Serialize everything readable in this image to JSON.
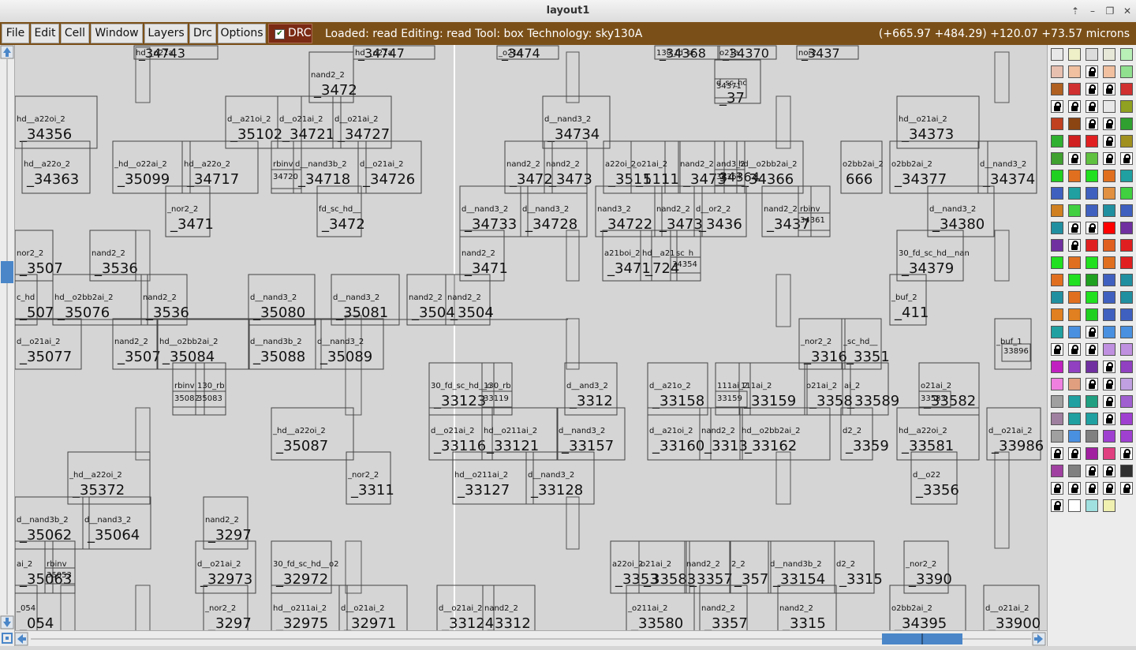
{
  "window": {
    "title": "layout1",
    "controls": [
      "up-arrow-icon",
      "minimize-icon",
      "maximize-icon",
      "close-icon"
    ]
  },
  "menu": {
    "items": [
      "File",
      "Edit",
      "Cell",
      "Window",
      "Layers",
      "Drc",
      "Options"
    ],
    "drc_toggle": {
      "label": "DRC",
      "checked": true
    }
  },
  "status": {
    "message": "Loaded: read Editing: read Tool: box  Technology: sky130A",
    "coordinates": "(+665.97 +484.29) +120.07 +73.57 microns"
  },
  "colors": {
    "menubar": "#7b5018",
    "drc_button": "#7b2a14",
    "scroll_thumb": "#4a86c8"
  },
  "scrollbars": {
    "horizontal_thumb_fraction": [
      0.838,
      0.925
    ],
    "vertical_thumb_fraction": [
      0.36,
      0.4
    ]
  },
  "cells": [
    {
      "small": "hd__o21a",
      "big": "_34743"
    },
    {
      "small": "hd__o21a",
      "big": "_34747"
    },
    {
      "small": "_o21a",
      "big": "_3474"
    },
    {
      "small": "130_fd_sc",
      "big": "_34368"
    },
    {
      "small": "o21a",
      "big": "_34370"
    },
    {
      "small": "nor2",
      "big": "_3437"
    },
    {
      "small": "nand2_2",
      "big": "_3472"
    },
    {
      "small": "d_sc_hc",
      "big": "_37"
    },
    {
      "small": "34371",
      "big": ""
    },
    {
      "small": "hd__a22oi_2",
      "big": "_34356"
    },
    {
      "small": "d__a21oi_2",
      "big": "_35102"
    },
    {
      "small": "d__o21ai_2",
      "big": "_34721"
    },
    {
      "small": "d__o21ai_2",
      "big": "_34727"
    },
    {
      "small": "d__nand3_2",
      "big": "_34734"
    },
    {
      "small": "hd__o21ai_2",
      "big": "_34373"
    },
    {
      "small": "hd__a22o_2",
      "big": "_34363"
    },
    {
      "small": "_hd__o22ai_2",
      "big": "_35099"
    },
    {
      "small": "hd__a22o_2",
      "big": "_34717"
    },
    {
      "small": "rbinv",
      "big": ""
    },
    {
      "small": "34720",
      "big": ""
    },
    {
      "small": "d__nand3b_2",
      "big": "_34718"
    },
    {
      "small": "d__o21ai_2",
      "big": "_34726"
    },
    {
      "small": "nand2_2",
      "big": "_3472"
    },
    {
      "small": "nand2_2",
      "big": "_3473"
    },
    {
      "small": "a22oi_2",
      "big": "_3511"
    },
    {
      "small": "_o21ai_2",
      "big": "_5111"
    },
    {
      "small": "nand2_2",
      "big": "_3473"
    },
    {
      "small": "and3_2",
      "big": ""
    },
    {
      "small": "34364",
      "big": "34364"
    },
    {
      "small": "hd__o2bb2ai_2",
      "big": "_34366"
    },
    {
      "small": "o2bb2ai_2",
      "big": "666"
    },
    {
      "small": "o2bb2ai_2",
      "big": "_34377"
    },
    {
      "small": "d__nand3_2",
      "big": "_34374"
    },
    {
      "small": "_nor2_2",
      "big": "_3471"
    },
    {
      "small": "fd_sc_hd__",
      "big": "_3472"
    },
    {
      "small": "d__nand3_2",
      "big": "_34733"
    },
    {
      "small": "d__nand3_2",
      "big": "_34728"
    },
    {
      "small": "nand3_2",
      "big": "_34722"
    },
    {
      "small": "nand2_2",
      "big": "_3473"
    },
    {
      "small": "d__or2_2",
      "big": "_3436"
    },
    {
      "small": "nand2_2",
      "big": "_3437"
    },
    {
      "small": "rbinv",
      "big": ""
    },
    {
      "small": "34361",
      "big": ""
    },
    {
      "small": "d__nand3_2",
      "big": "_34380"
    },
    {
      "small": "nor2_2",
      "big": "_3507"
    },
    {
      "small": "nand2_2",
      "big": "_3536"
    },
    {
      "small": "nand2_2",
      "big": "_3471"
    },
    {
      "small": "a21boi_2",
      "big": "_3471"
    },
    {
      "small": "hd__a21",
      "big": "_724"
    },
    {
      "small": "_sc_h",
      "big": ""
    },
    {
      "small": "34354",
      "big": ""
    },
    {
      "small": "30_fd_sc_hd__nan",
      "big": "_34379"
    },
    {
      "small": "c_hd",
      "big": "_507"
    },
    {
      "small": "hd__o2bb2ai_2",
      "big": "_35076"
    },
    {
      "small": "nand2_2",
      "big": "_3536"
    },
    {
      "small": "d__nand3_2",
      "big": "_35080"
    },
    {
      "small": "d__nand3_2",
      "big": "_35081"
    },
    {
      "small": "nand2_2",
      "big": "_3504"
    },
    {
      "small": "nand2_2",
      "big": "_3504"
    },
    {
      "small": "_buf_2",
      "big": "_411"
    },
    {
      "small": "d__o21ai_2",
      "big": "_35077"
    },
    {
      "small": "nand2_2",
      "big": "_3507"
    },
    {
      "small": "hd__o2bb2ai_2",
      "big": "_35084"
    },
    {
      "small": "d__nand3b_2",
      "big": "_35088"
    },
    {
      "small": "d__nand3_2",
      "big": "_35089"
    },
    {
      "small": "_nor2_2",
      "big": "_3316"
    },
    {
      "small": "_sc_hd__",
      "big": "_3351"
    },
    {
      "small": "_buf_1",
      "big": ""
    },
    {
      "small": "33896",
      "big": ""
    },
    {
      "small": "rbinv",
      "big": ""
    },
    {
      "small": "130_rb",
      "big": ""
    },
    {
      "small": "35082",
      "big": ""
    },
    {
      "small": "35083",
      "big": ""
    },
    {
      "small": "30_fd_sc_hd__o",
      "big": "_33123"
    },
    {
      "small": "130_rb",
      "big": ""
    },
    {
      "small": "33119",
      "big": ""
    },
    {
      "small": "d__and3_2",
      "big": "_3312"
    },
    {
      "small": "d__a21o_2",
      "big": "_33158"
    },
    {
      "small": "111ai_2",
      "big": ""
    },
    {
      "small": "33159",
      "big": ""
    },
    {
      "small": "111ai_2",
      "big": "_33159"
    },
    {
      "small": "o21ai_2",
      "big": "_3358"
    },
    {
      "small": "ai_2",
      "big": "_33589"
    },
    {
      "small": "o21ai_2",
      "big": "_33582"
    },
    {
      "small": "33583",
      "big": ""
    },
    {
      "small": "_hd__a22oi_2",
      "big": "_35087"
    },
    {
      "small": "d__o21ai_2",
      "big": "_33116"
    },
    {
      "small": "hd__o211ai_2",
      "big": "_33121"
    },
    {
      "small": "d__nand3_2",
      "big": "_33157"
    },
    {
      "small": "d__a21oi_2",
      "big": "_33160"
    },
    {
      "small": "nand2_2",
      "big": "_3313"
    },
    {
      "small": "hd__o2bb2ai_2",
      "big": "_33162"
    },
    {
      "small": "d2_2",
      "big": "_3359"
    },
    {
      "small": "hd__a22oi_2",
      "big": "_33581"
    },
    {
      "small": "d__o21ai_2",
      "big": "_33986"
    },
    {
      "small": "_hd__a22oi_2",
      "big": "_35372"
    },
    {
      "small": "_nor2_2",
      "big": "_3311"
    },
    {
      "small": "hd__o211ai_2",
      "big": "_33127"
    },
    {
      "small": "d__nand3_2",
      "big": "_33128"
    },
    {
      "small": "d__o22",
      "big": "_3356"
    },
    {
      "small": "d__nand3b_2",
      "big": "_35062"
    },
    {
      "small": "d__nand3_2",
      "big": "_35064"
    },
    {
      "small": "nand2_2",
      "big": "_3297"
    },
    {
      "small": "ai_2",
      "big": "_35063"
    },
    {
      "small": "rbinv",
      "big": ""
    },
    {
      "small": "35053",
      "big": ""
    },
    {
      "small": "d__o21ai_2",
      "big": "_32973"
    },
    {
      "small": "30_fd_sc_hd__o2",
      "big": "_32972"
    },
    {
      "small": "a22oi_2",
      "big": "_3353"
    },
    {
      "small": "o21ai_2",
      "big": "_33583"
    },
    {
      "small": "nand2_2",
      "big": "_3357"
    },
    {
      "small": "2_2",
      "big": "_357"
    },
    {
      "small": "d__nand3b_2",
      "big": "_33154"
    },
    {
      "small": "d2_2",
      "big": "_3315"
    },
    {
      "small": "_nor2_2",
      "big": "_3390"
    },
    {
      "small": "_054",
      "big": "_054"
    },
    {
      "small": "_nor2_2",
      "big": "_3297"
    },
    {
      "small": "hd__o211ai_2",
      "big": "_32975"
    },
    {
      "small": "d__o21ai_2",
      "big": "_32971"
    },
    {
      "small": "d__o21ai_2",
      "big": "_33124"
    },
    {
      "small": "nand2_2",
      "big": "_3312"
    },
    {
      "small": "_o211ai_2",
      "big": "_33580"
    },
    {
      "small": "nand2_2",
      "big": "_3357"
    },
    {
      "small": "nand2_2",
      "big": "_3315"
    },
    {
      "small": "o2bb2ai_2",
      "big": "_34395"
    },
    {
      "small": "d__o21ai_2",
      "big": "_33900"
    }
  ]
}
